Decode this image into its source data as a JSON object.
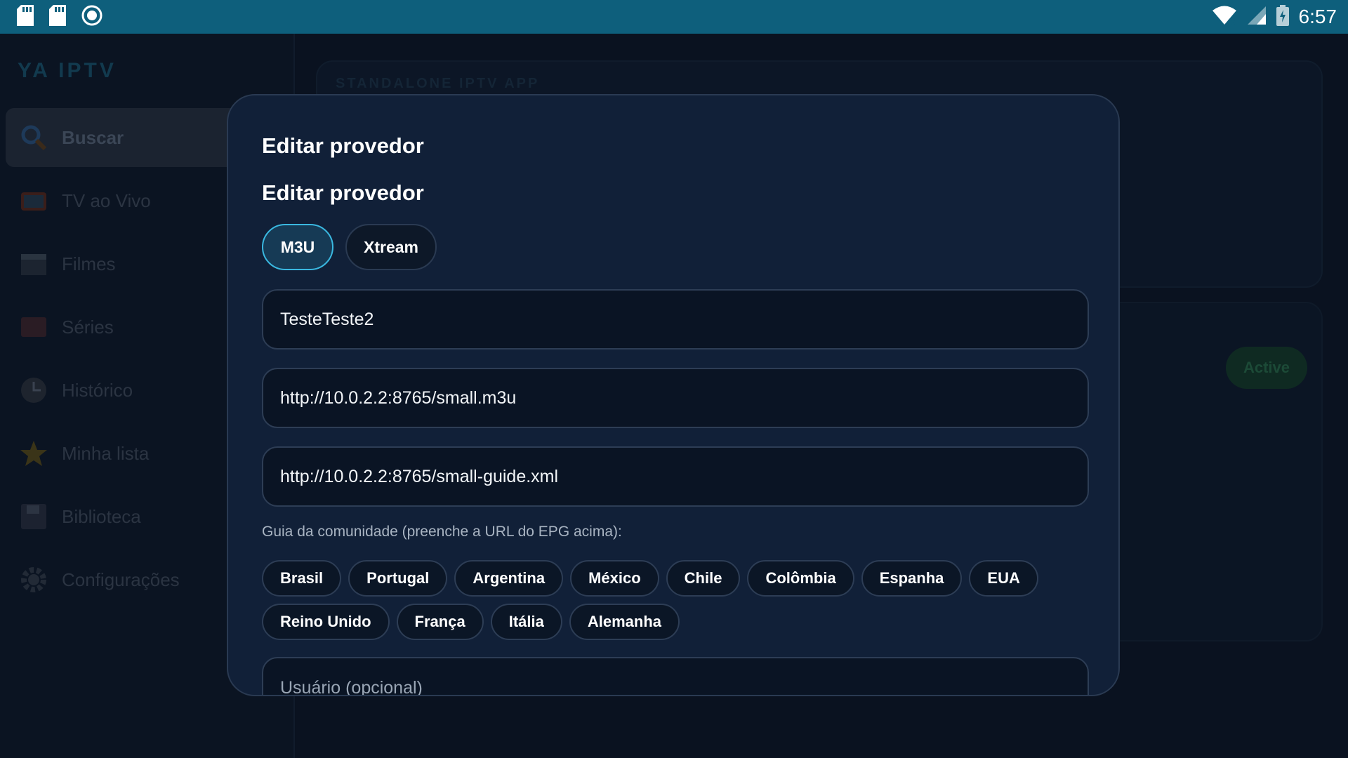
{
  "status_bar": {
    "time": "6:57",
    "left_icons": [
      "sd-card-icon",
      "sd-card-icon",
      "record-icon"
    ],
    "right_icons": [
      "wifi-icon",
      "cell-signal-icon",
      "battery-charging-icon"
    ]
  },
  "sidebar": {
    "brand": "YA IPTV",
    "items": [
      {
        "label": "Buscar",
        "icon": "search-icon",
        "active": true
      },
      {
        "label": "TV ao Vivo",
        "icon": "tv-icon"
      },
      {
        "label": "Filmes",
        "icon": "clapperboard-icon"
      },
      {
        "label": "Séries",
        "icon": "series-icon"
      },
      {
        "label": "Histórico",
        "icon": "clock-icon"
      },
      {
        "label": "Minha lista",
        "icon": "star-icon"
      },
      {
        "label": "Biblioteca",
        "icon": "floppy-icon"
      },
      {
        "label": "Configurações",
        "icon": "gear-icon"
      }
    ]
  },
  "background": {
    "subtitle": "STANDALONE IPTV APP",
    "badge": "Active"
  },
  "dialog": {
    "title": "Editar provedor",
    "subtitle": "Editar provedor",
    "type_options": [
      {
        "label": "M3U",
        "selected": true
      },
      {
        "label": "Xtream",
        "selected": false
      }
    ],
    "fields": {
      "name": "TesteTeste2",
      "playlist_url": "http://10.0.2.2:8765/small.m3u",
      "epg_url": "http://10.0.2.2:8765/small-guide.xml",
      "username_placeholder": "Usuário (opcional)"
    },
    "community_hint": "Guia da comunidade (preenche a URL do EPG acima):",
    "countries_row1": [
      "Brasil",
      "Portugal",
      "Argentina",
      "México",
      "Chile",
      "Colômbia",
      "Espanha",
      "EUA"
    ],
    "countries_row2": [
      "Reino Unido",
      "França",
      "Itália",
      "Alemanha"
    ]
  },
  "colors": {
    "status_bar": "#0e5f7c",
    "dialog_bg": "#112038",
    "accent": "#3ab8e0"
  }
}
